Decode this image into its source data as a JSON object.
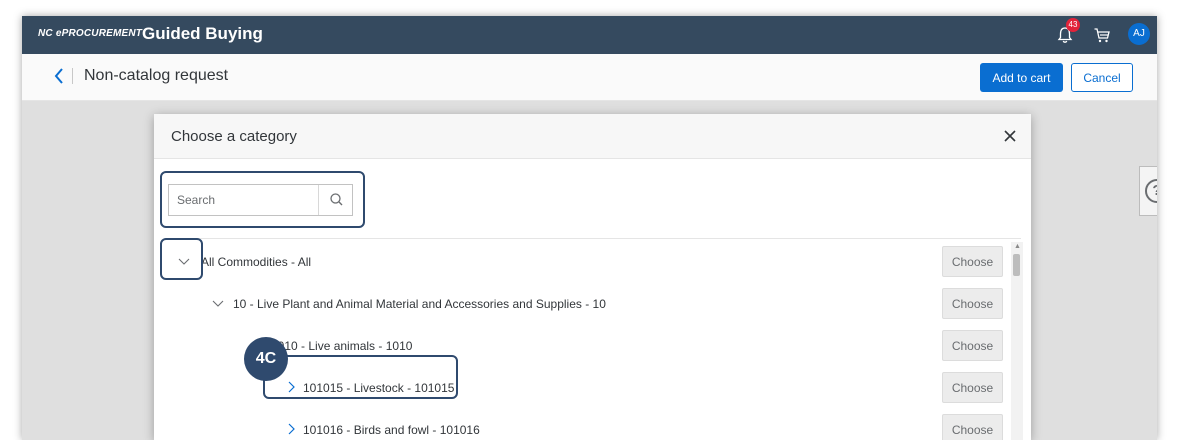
{
  "shell": {
    "brand_small": "NC ePROCUREMENT",
    "brand_title": "Guided Buying",
    "notification_count": "43",
    "avatar_initials": "AJ"
  },
  "page": {
    "title": "Non-catalog request",
    "add_to_cart_label": "Add to cart",
    "cancel_label": "Cancel",
    "help_label": "?"
  },
  "dialog": {
    "title": "Choose a category",
    "search_placeholder": "Search",
    "tree": [
      {
        "label": "All Commodities - All",
        "expanded": true,
        "choose_label": "Choose"
      },
      {
        "label": "10 - Live Plant and Animal Material and Accessories and Supplies - 10",
        "expanded": true,
        "choose_label": "Choose"
      },
      {
        "label": "1010 - Live animals - 1010",
        "expanded": true,
        "choose_label": "Choose"
      },
      {
        "label": "101015 - Livestock - 101015",
        "expanded": false,
        "choose_label": "Choose"
      },
      {
        "label": "101016 - Birds and fowl - 101016",
        "expanded": false,
        "choose_label": "Choose"
      }
    ]
  },
  "annotation": {
    "callout_label": "4C"
  },
  "colors": {
    "shell": "#354a5f",
    "accent": "#0a6ed1",
    "highlight": "#2f4a6e",
    "badge": "#e2233a"
  },
  "icons": [
    "back-chevron-icon",
    "bell-icon",
    "cart-icon",
    "close-icon",
    "search-icon",
    "chevron-down-icon",
    "chevron-right-icon",
    "help-icon"
  ]
}
